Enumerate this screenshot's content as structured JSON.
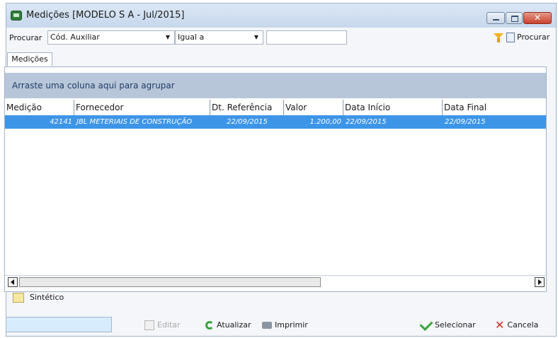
{
  "window": {
    "title": "Medições [MODELO S A - Jul/2015]",
    "close_glyph": "✕"
  },
  "search": {
    "label": "Procurar",
    "field": "Cód. Auxiliar",
    "condition": "Igual a",
    "value": "",
    "button_label": "Procurar",
    "arrow_glyph": "▼"
  },
  "tabs": [
    {
      "label": "Medições"
    }
  ],
  "group_panel": {
    "text": "Arraste uma coluna aqui para agrupar"
  },
  "table": {
    "columns": [
      "Medição",
      "Fornecedor",
      "Dt. Referência",
      "Valor",
      "Data Início",
      "Data Final"
    ],
    "rows": [
      [
        "42141",
        "JBL METERIAIS DE CONSTRUÇÃO",
        "22/09/2015",
        "1.200,00",
        "22/09/2015",
        "22/09/2015"
      ]
    ],
    "selected_row_color": "#3d95e8"
  },
  "options": {
    "sintetico_label": "Sintético",
    "sintetico_color": "#f6e7a1"
  },
  "buttons": {
    "editar": "Editar",
    "atualizar": "Atualizar",
    "imprimir": "Imprimir",
    "selecionar": "Selecionar",
    "cancela": "Cancela",
    "cancel_glyph": "✕"
  },
  "icons": [
    "app-icon",
    "minimize-icon",
    "maximize-icon",
    "close-icon",
    "filter-icon",
    "search-doc-icon",
    "scroll-left-icon",
    "scroll-right-icon",
    "edit-icon",
    "refresh-icon",
    "print-icon",
    "check-icon",
    "cancel-icon"
  ]
}
